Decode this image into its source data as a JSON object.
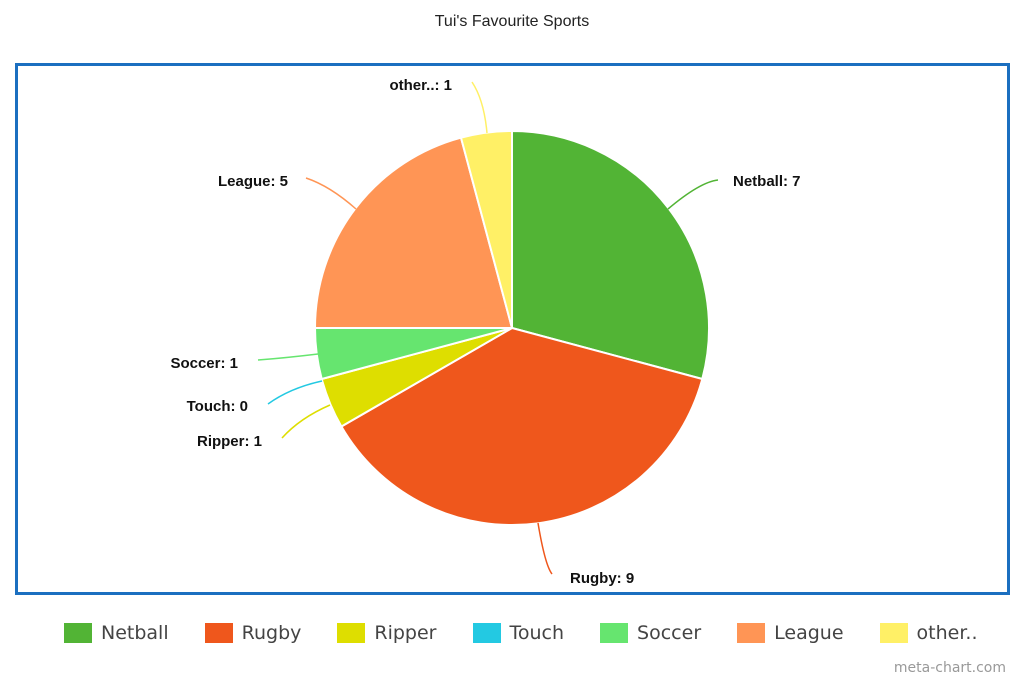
{
  "chart_data": {
    "type": "pie",
    "title": "Tui's Favourite Sports",
    "categories": [
      "Netball",
      "Rugby",
      "Ripper",
      "Touch",
      "Soccer",
      "League",
      "other.."
    ],
    "values": [
      7,
      9,
      1,
      0,
      1,
      5,
      1
    ],
    "colors": [
      "#52b435",
      "#ef571c",
      "#dede00",
      "#23c9e2",
      "#66e56f",
      "#ff9555",
      "#fff066"
    ],
    "data_labels": [
      "Netball: 7",
      "Rugby: 9",
      "Ripper: 1",
      "Touch: 0",
      "Soccer: 1",
      "League: 5",
      "other..: 1"
    ],
    "start_angle": "12 o'clock",
    "direction": "clockwise",
    "legend_position": "bottom"
  },
  "credit": "meta-chart.com"
}
